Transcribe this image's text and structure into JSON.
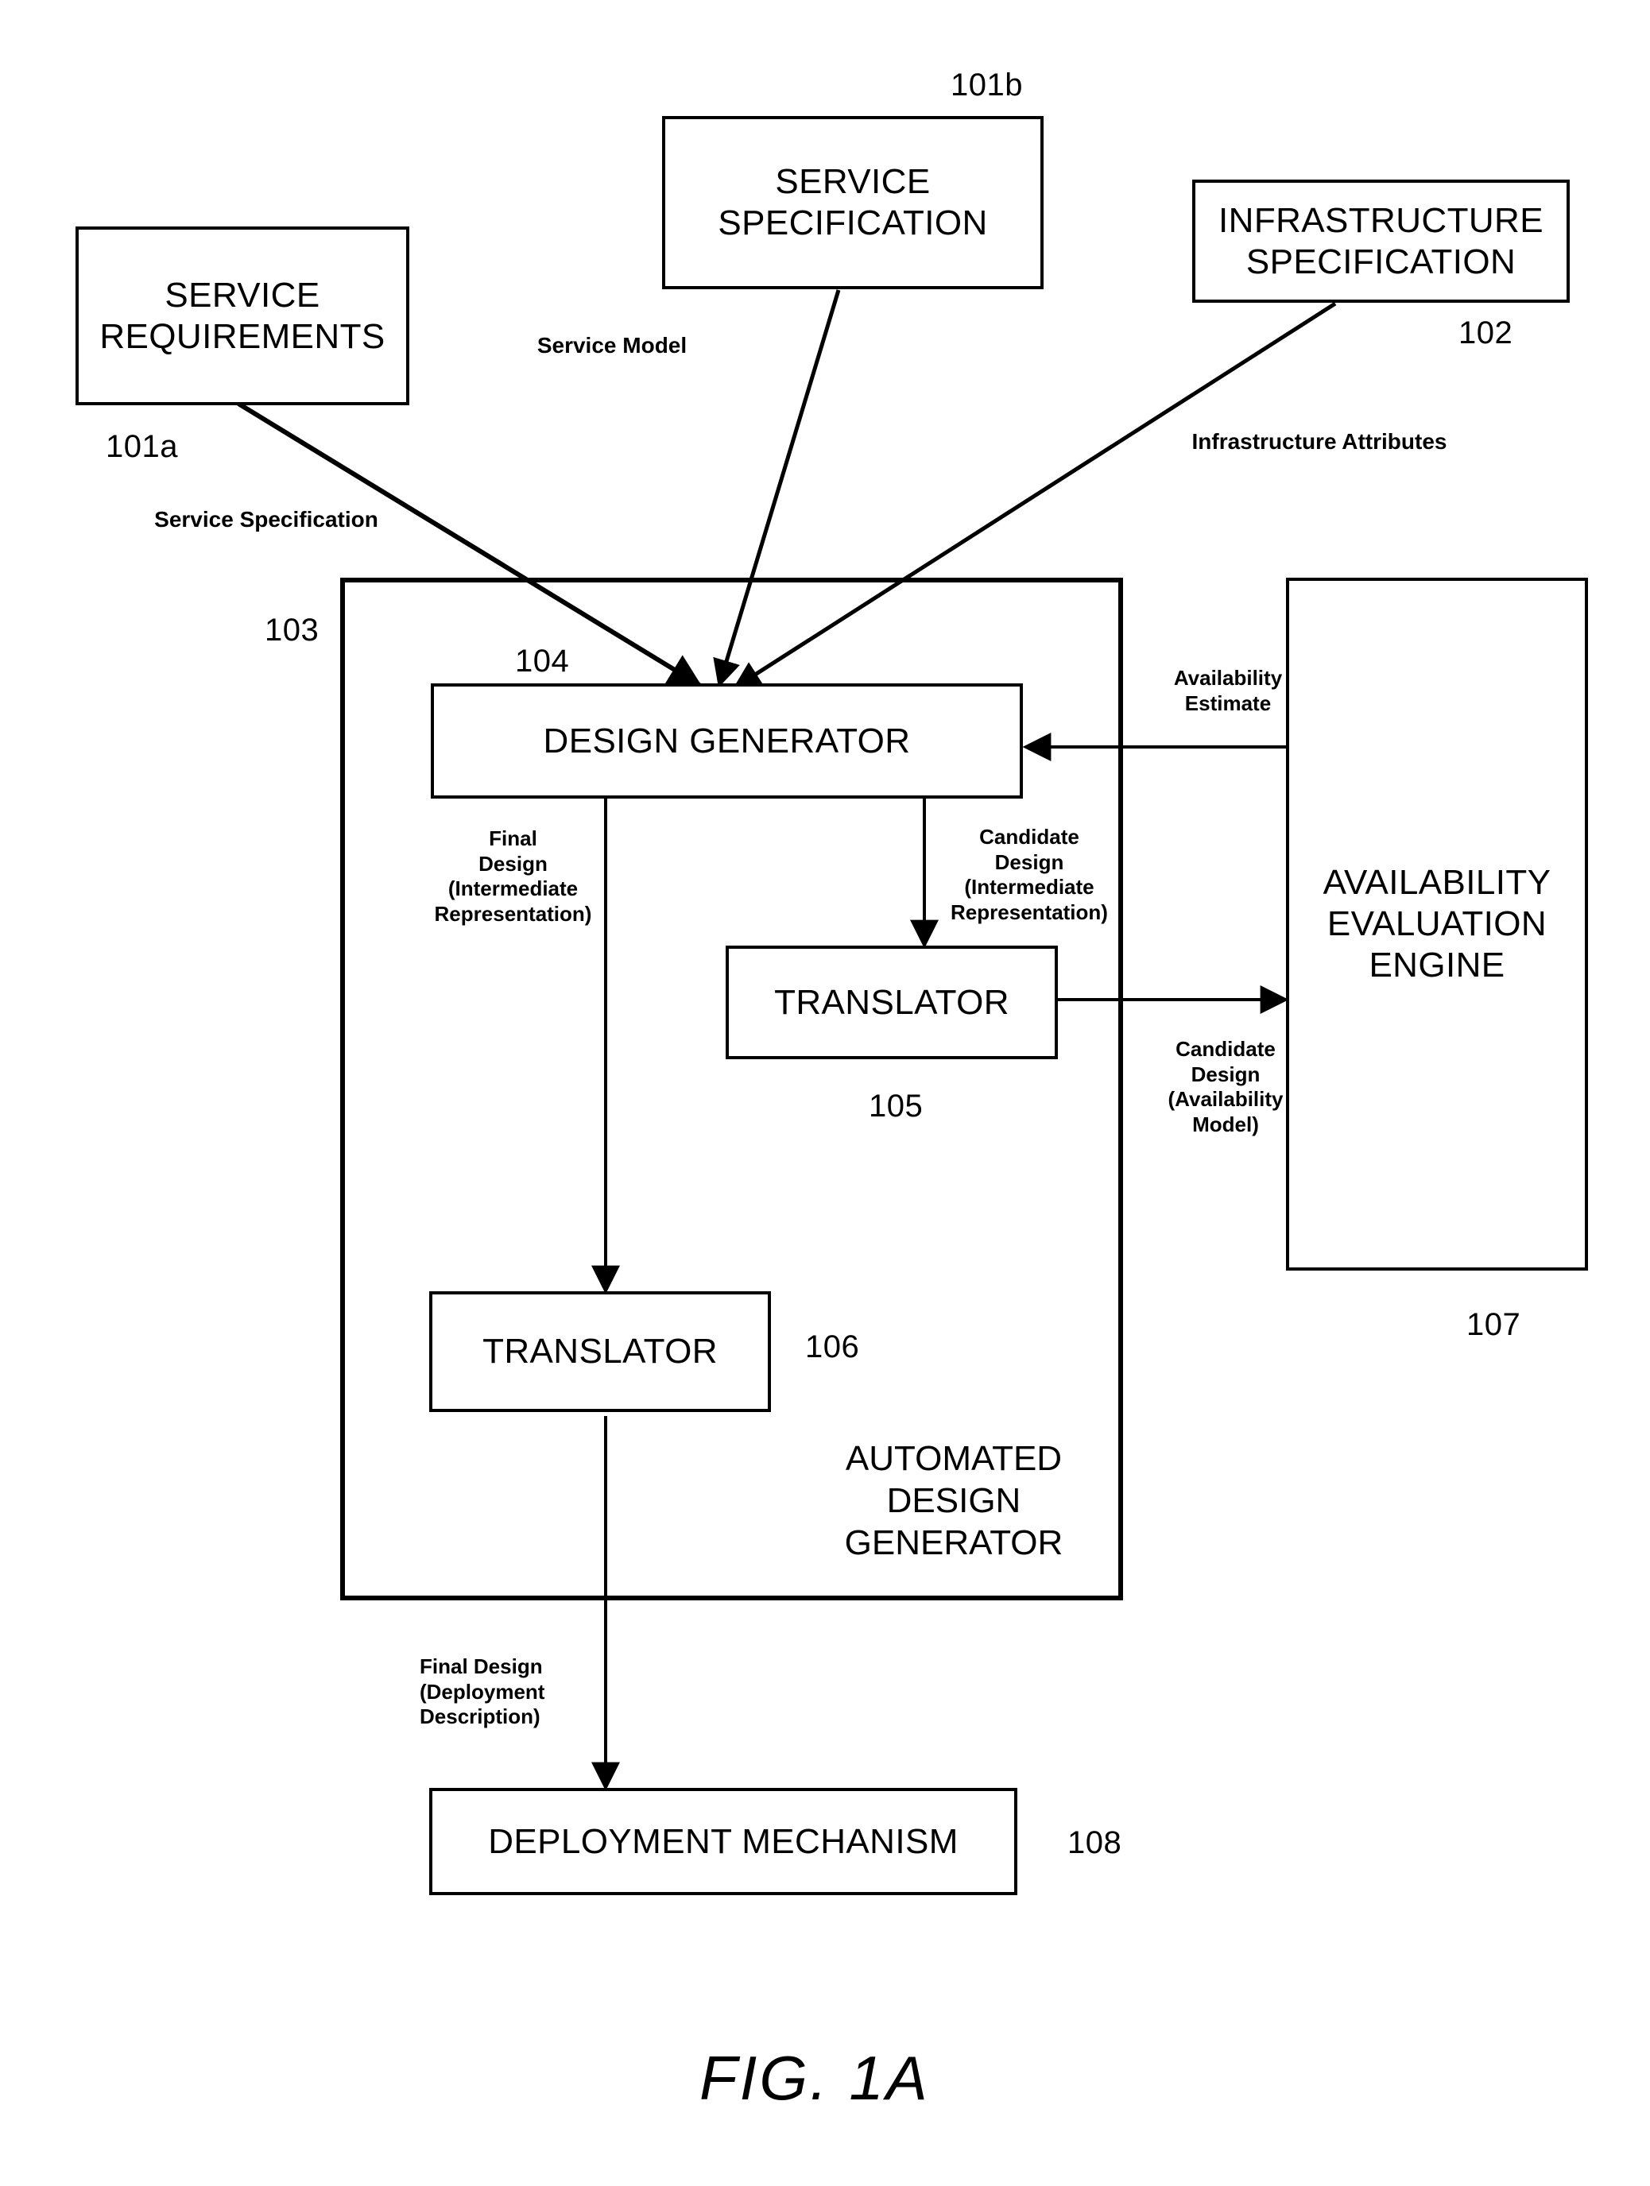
{
  "figure": {
    "caption": "FIG. 1A"
  },
  "boxes": {
    "service_requirements": {
      "label": "SERVICE\nREQUIREMENTS",
      "ref": "101a"
    },
    "service_specification": {
      "label": "SERVICE\nSPECIFICATION",
      "ref": "101b"
    },
    "infrastructure_specification": {
      "label": "INFRASTRUCTURE\nSPECIFICATION",
      "ref": "102"
    },
    "automated_design_generator": {
      "label": "AUTOMATED\nDESIGN\nGENERATOR",
      "ref": "103"
    },
    "design_generator": {
      "label": "DESIGN GENERATOR",
      "ref": "104"
    },
    "translator_candidate": {
      "label": "TRANSLATOR",
      "ref": "105"
    },
    "translator_final": {
      "label": "TRANSLATOR",
      "ref": "106"
    },
    "availability_evaluation_engine": {
      "label": "AVAILABILITY\nEVALUATION\nENGINE",
      "ref": "107"
    },
    "deployment_mechanism": {
      "label": "DEPLOYMENT MECHANISM",
      "ref": "108"
    }
  },
  "flow_labels": {
    "service_specification_flow": "Service Specification",
    "service_model_flow": "Service Model",
    "infrastructure_attributes_flow": "Infrastructure Attributes",
    "availability_estimate_flow": "Availability\nEstimate",
    "final_design_intermediate_flow": "Final\nDesign\n(Intermediate\nRepresentation)",
    "candidate_design_intermediate_flow": "Candidate\nDesign\n(Intermediate\nRepresentation)",
    "candidate_design_availability_flow": "Candidate\nDesign\n(Availability\nModel)",
    "final_design_deployment_flow": "Final Design\n(Deployment\nDescription)"
  },
  "colors": {
    "stroke": "#000000",
    "background": "#ffffff"
  }
}
